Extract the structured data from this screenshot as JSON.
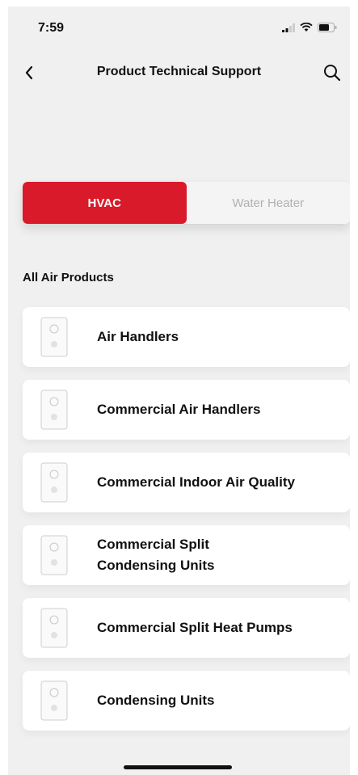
{
  "status_bar": {
    "time": "7:59"
  },
  "header": {
    "title": "Product Technical Support"
  },
  "tabs": [
    {
      "label": "HVAC",
      "active": true
    },
    {
      "label": "Water Heater",
      "active": false
    }
  ],
  "section": {
    "title": "All Air Products"
  },
  "products": [
    {
      "label": "Air Handlers"
    },
    {
      "label": "Commercial Air Handlers"
    },
    {
      "label": "Commercial Indoor Air Quality"
    },
    {
      "label": "Commercial Split\nCondensing Units"
    },
    {
      "label": "Commercial Split Heat Pumps"
    },
    {
      "label": "Condensing Units"
    }
  ],
  "colors": {
    "accent": "#d91a2a",
    "background": "#f0f0f0",
    "card": "#ffffff"
  },
  "icons": [
    "back-chevron-icon",
    "search-icon",
    "signal-icon",
    "wifi-icon",
    "battery-icon",
    "product-unit-icon"
  ]
}
